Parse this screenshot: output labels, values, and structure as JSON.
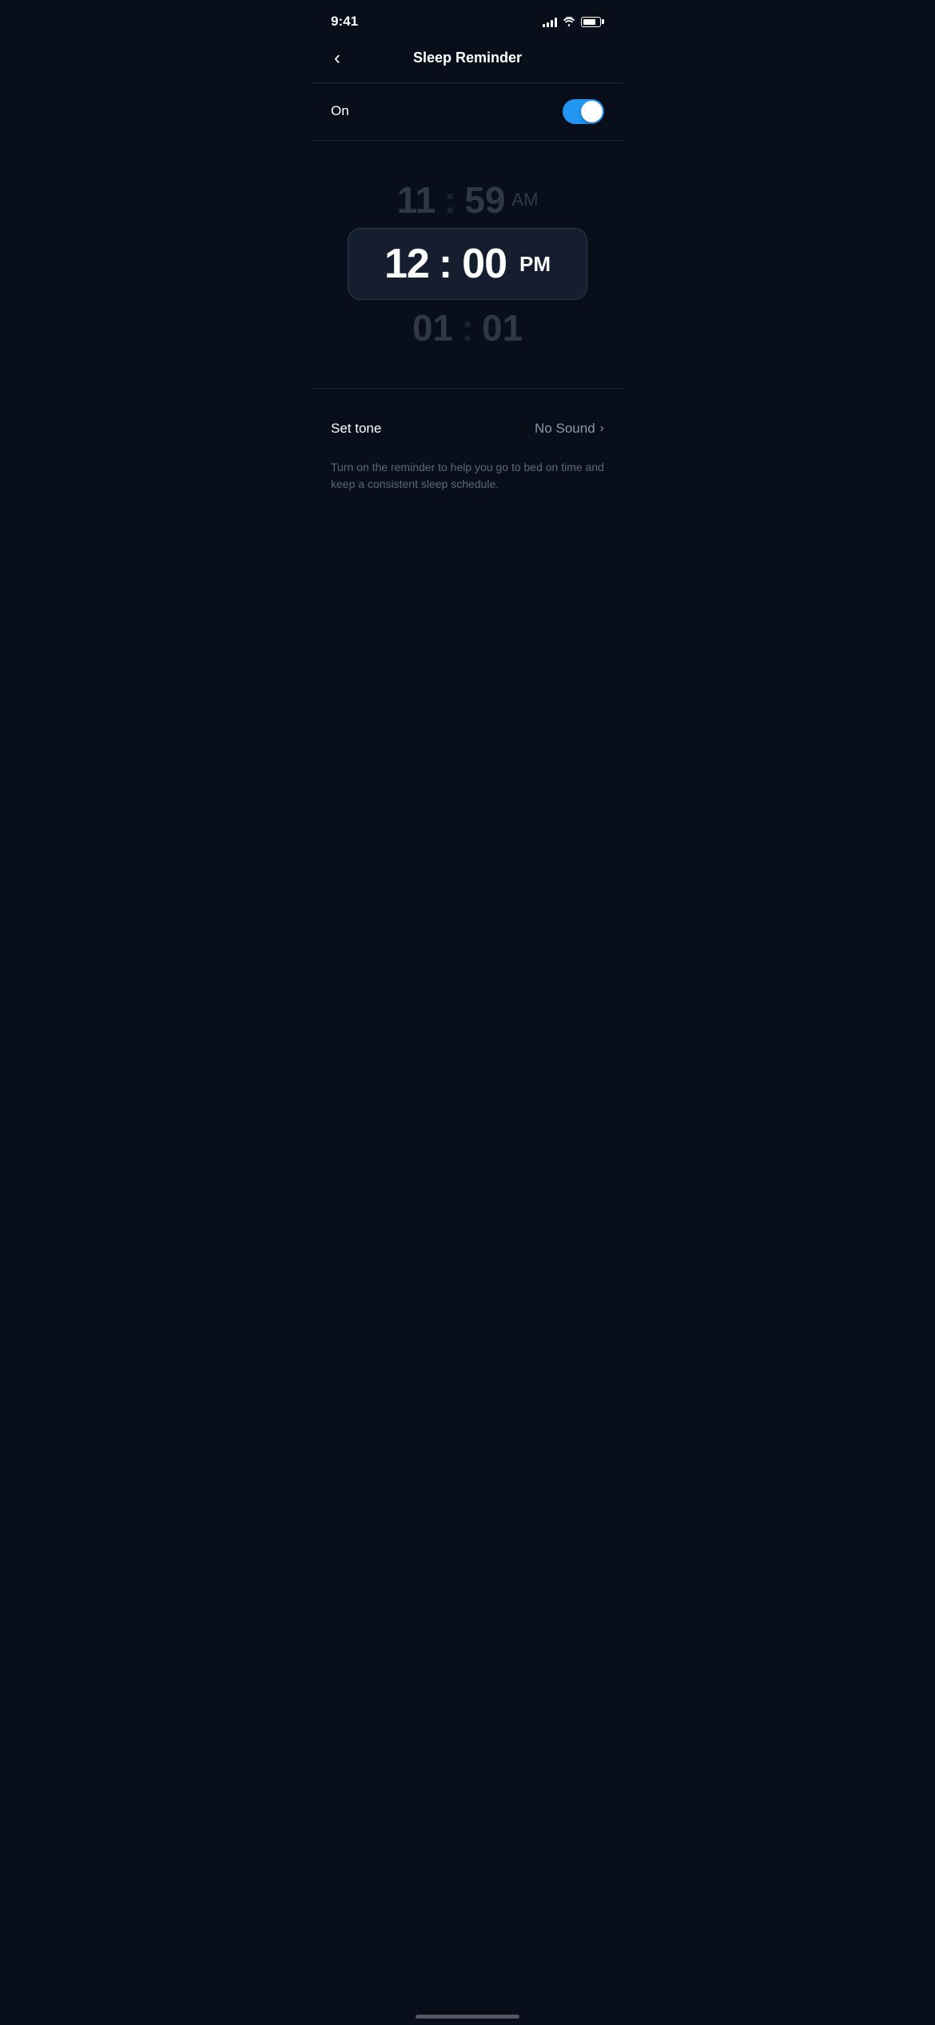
{
  "statusBar": {
    "time": "9:41",
    "signalBars": [
      4,
      6,
      8,
      10,
      12
    ],
    "batteryLevel": 80
  },
  "header": {
    "backLabel": "‹",
    "title": "Sleep Reminder"
  },
  "toggleRow": {
    "label": "On",
    "isOn": true
  },
  "timePicker": {
    "ghostAboveHour": "11",
    "ghostAboveMinute": "59",
    "ghostAbovePeriod": "AM",
    "activeHour": "12",
    "activeMinute": "00",
    "activePeriod": "PM",
    "colon": ":",
    "ghostBelowHour": "01",
    "ghostBelowMinute": "01"
  },
  "setTone": {
    "label": "Set tone",
    "value": "No Sound",
    "chevron": "›"
  },
  "description": {
    "text": "Turn on the reminder to help you go to bed on time and keep a consistent sleep schedule."
  }
}
